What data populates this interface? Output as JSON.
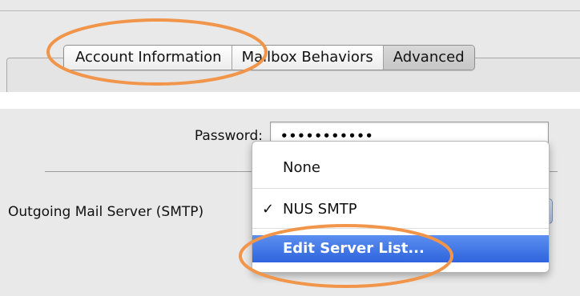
{
  "tabs": [
    {
      "label": "Account Information",
      "selected": false
    },
    {
      "label": "Mailbox Behaviors",
      "selected": false
    },
    {
      "label": "Advanced",
      "selected": true
    }
  ],
  "account": {
    "password_label": "Password:",
    "password_value": "•••••••••••",
    "smtp_label": "Outgoing Mail Server (SMTP)"
  },
  "smtp_menu": {
    "items": [
      {
        "label": "None",
        "checked": false,
        "highlighted": false
      },
      {
        "label": "NUS SMTP",
        "checked": true,
        "highlighted": false
      },
      {
        "label": "Edit Server List...",
        "checked": false,
        "highlighted": true
      }
    ],
    "check_mark": "✓"
  },
  "colors": {
    "annotation": "#f0954a",
    "menu_highlight": "#3a6fe2",
    "window_background": "#e9e9e9"
  }
}
